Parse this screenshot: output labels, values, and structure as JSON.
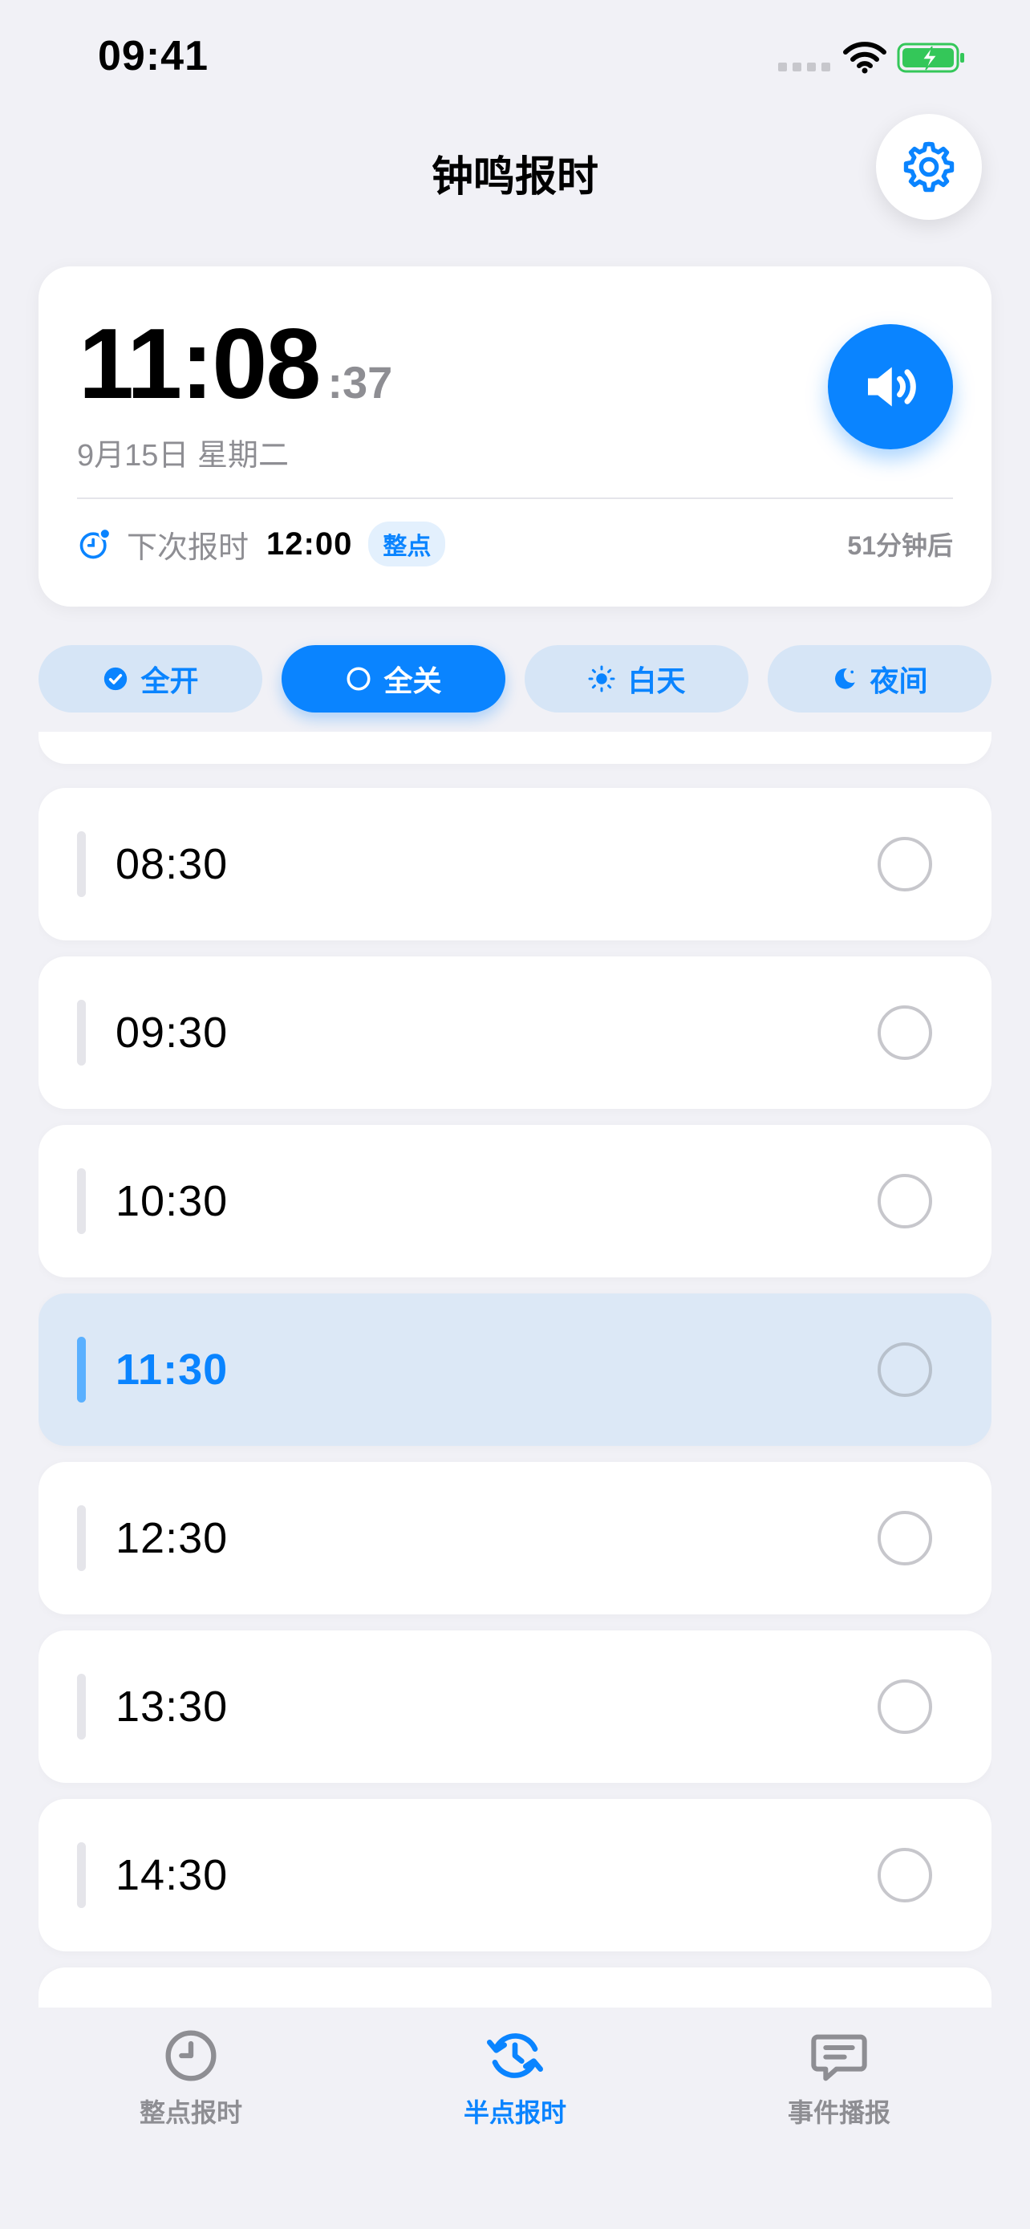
{
  "status_bar": {
    "time": "09:41"
  },
  "header": {
    "title": "钟鸣报时"
  },
  "clock": {
    "hours_minutes": "11:08",
    "seconds": ":37",
    "date": "9月15日 星期二",
    "next_label": "下次报时",
    "next_time": "12:00",
    "next_badge": "整点",
    "remaining": "51分钟后"
  },
  "filters": [
    {
      "label": "全开",
      "icon": "check-circle-icon"
    },
    {
      "label": "全关",
      "icon": "circle-outline-icon",
      "active": true
    },
    {
      "label": "白天",
      "icon": "sun-icon"
    },
    {
      "label": "夜间",
      "icon": "moon-icon"
    }
  ],
  "slots": [
    {
      "time": "08:30",
      "enabled": false
    },
    {
      "time": "09:30",
      "enabled": false
    },
    {
      "time": "10:30",
      "enabled": false
    },
    {
      "time": "11:30",
      "enabled": false,
      "current": true
    },
    {
      "time": "12:30",
      "enabled": false
    },
    {
      "time": "13:30",
      "enabled": false
    },
    {
      "time": "14:30",
      "enabled": false
    }
  ],
  "tabs": [
    {
      "label": "整点报时",
      "icon": "clock-icon"
    },
    {
      "label": "半点报时",
      "icon": "clock-rotate-icon",
      "active": true
    },
    {
      "label": "事件播报",
      "icon": "message-icon"
    }
  ],
  "colors": {
    "accent": "#0A84FF",
    "background": "#F1F1F6",
    "battery": "#34C759"
  }
}
